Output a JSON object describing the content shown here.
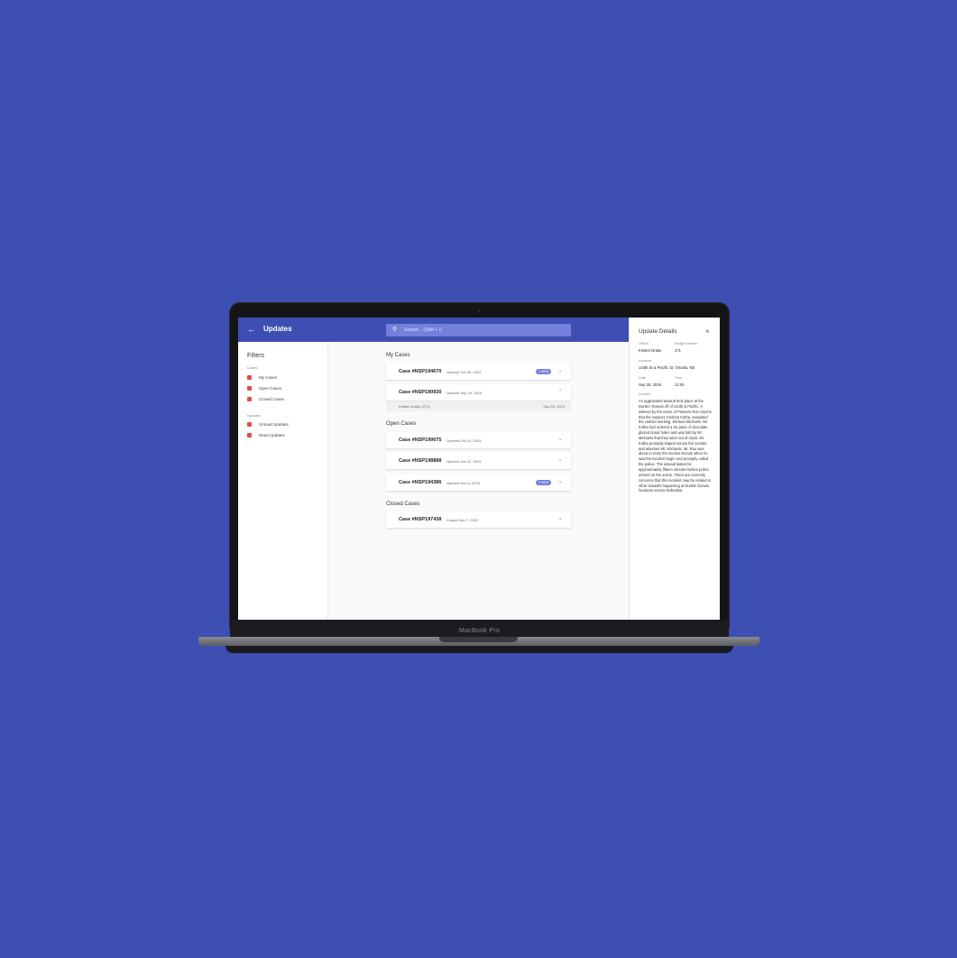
{
  "laptop": {
    "model_label": "MacBook Pro"
  },
  "header": {
    "back_icon": "arrow-left-icon",
    "title": "Updates",
    "search_placeholder": "Search... (Shift + /)"
  },
  "filters": {
    "title": "Filters",
    "cases_label": "Cases",
    "cases": [
      "My Cases",
      "Open Cases",
      "Closed Cases"
    ],
    "updates_label": "Updates",
    "updates": [
      "Unread Updates",
      "Read Updates"
    ],
    "checkbox_color": "#e94848"
  },
  "sections": {
    "my_cases": {
      "title": "My Cases",
      "cases": [
        {
          "id": "Case #NSP194670",
          "date": "Opened Oct 30, 2019",
          "badge": "1 NEW",
          "expanded": false
        },
        {
          "id": "Case #NSP190930",
          "date": "Opened Sep 26, 2019",
          "badge": "",
          "expanded": true,
          "update": {
            "officer": "Kristen Drake (271)",
            "date": "Sep 26, 2019"
          }
        }
      ]
    },
    "open_cases": {
      "title": "Open Cases",
      "cases": [
        {
          "id": "Case #NSP199075",
          "date": "Opened Oct 14, 2019",
          "badge": ""
        },
        {
          "id": "Case #NSP198888",
          "date": "Opened Oct 22, 2019",
          "badge": ""
        },
        {
          "id": "Case #NSP194386",
          "date": "Opened Nov 5, 2019",
          "badge": "2 NEW"
        }
      ]
    },
    "closed_cases": {
      "title": "Closed Cases",
      "cases": [
        {
          "id": "Case #NSP197438",
          "date": "Closed Dec 7, 2019",
          "badge": ""
        }
      ]
    }
  },
  "details": {
    "title": "Update Details",
    "close_icon": "close-icon",
    "officer_label": "Officer",
    "officer": "Kristen Drake",
    "badge_label": "Badge Number",
    "badge": "271",
    "location_label": "Location",
    "location": "144th St & Pacific St, Omaha, NE",
    "date_label": "Date",
    "date": "Sep 26, 2019",
    "time_label": "Time",
    "time": "21:00",
    "content_label": "Content",
    "content": "An aggravated assault took place at the Dunkin' Donuts off of 144th & Pacific. A witness by the name of Praveen Rao reports that the suspect, Krishna Kotha, assaulted the cashier working, Michael Michaels. Mr. Kotha had ordered a six pack of chocolate glazed donut holes and was told by Mr. Michaels that they were out of stock. Mr. Kotha promptly leaped across the counter and attacked Mr. Michaels. Mr. Rao was about to enter the Dunkin Donuts when he saw the incident begin and promptly called the police. The assault lasted for approximately fifteen minutes before police arrived on the scene. There are currently concerns that this incident may be related to other assaults happening at Dunkin Donuts locations across Nebraska."
  },
  "colors": {
    "background": "#3d4fb3",
    "header": "#3d4fb3",
    "search": "#7380dc",
    "badge": "#7380dc"
  }
}
